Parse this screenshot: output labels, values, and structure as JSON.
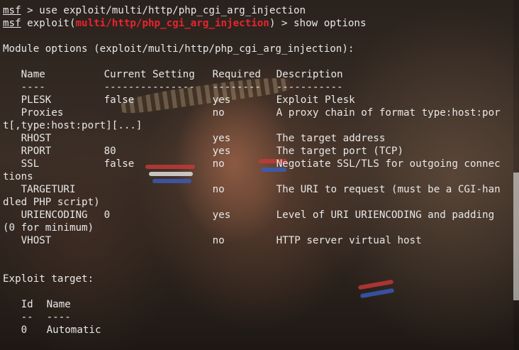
{
  "prompt1": {
    "prefix": "msf",
    "text": " > use exploit/multi/http/php_cgi_arg_injection"
  },
  "prompt2": {
    "prefix": "msf",
    "mid": " exploit(",
    "module": "multi/http/php_cgi_arg_injection",
    "suffix": ") > show options"
  },
  "module_heading": "Module options (exploit/multi/http/php_cgi_arg_injection):",
  "options_table": {
    "headers": [
      "Name",
      "Current Setting",
      "Required",
      "Description"
    ],
    "separators": [
      "----",
      "---------------",
      "--------",
      "-----------"
    ],
    "rows": [
      {
        "name": "PLESK",
        "setting": "false",
        "required": "yes",
        "description": "Exploit Plesk",
        "wrap": ""
      },
      {
        "name": "Proxies",
        "setting": "",
        "required": "no",
        "description": "A proxy chain of format type:host:por",
        "wrap": "t[,type:host:port][...]"
      },
      {
        "name": "RHOST",
        "setting": "",
        "required": "yes",
        "description": "The target address",
        "wrap": ""
      },
      {
        "name": "RPORT",
        "setting": "80",
        "required": "yes",
        "description": "The target port (TCP)",
        "wrap": ""
      },
      {
        "name": "SSL",
        "setting": "false",
        "required": "no",
        "description": "Negotiate SSL/TLS for outgoing connec",
        "wrap": "tions"
      },
      {
        "name": "TARGETURI",
        "setting": "",
        "required": "no",
        "description": "The URI to request (must be a CGI-han",
        "wrap": "dled PHP script)"
      },
      {
        "name": "URIENCODING",
        "setting": "0",
        "required": "yes",
        "description": "Level of URI URIENCODING and padding",
        "wrap": "(0 for minimum)"
      },
      {
        "name": "VHOST",
        "setting": "",
        "required": "no",
        "description": "HTTP server virtual host",
        "wrap": ""
      }
    ]
  },
  "exploit_target_heading": "Exploit target:",
  "target_table": {
    "headers": [
      "Id",
      "Name"
    ],
    "separators": [
      "--",
      "----"
    ],
    "rows": [
      {
        "id": "0",
        "name": "Automatic"
      }
    ]
  },
  "colors": {
    "text": "#e8e8e8",
    "module_highlight": "#e8242e"
  }
}
